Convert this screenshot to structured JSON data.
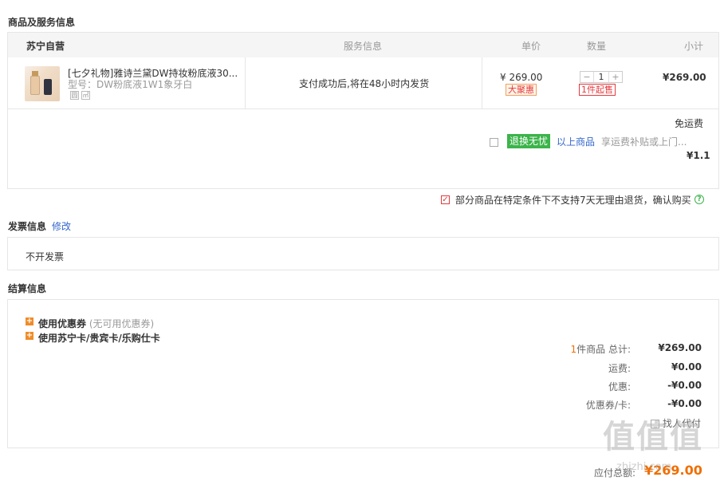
{
  "sections": {
    "goods_title": "商品及服务信息",
    "invoice_title": "发票信息",
    "invoice_edit": "修改",
    "settlement_title": "结算信息"
  },
  "order_table": {
    "store": "苏宁自营",
    "col_service": "服务信息",
    "col_price": "单价",
    "col_qty": "数量",
    "col_subtotal": "小计"
  },
  "product": {
    "name": "[七夕礼物]雅诗兰黛DW持妆粉底液30...",
    "model": "型号：DW粉底液1W1象牙白",
    "service": "支付成功后,将在48小时内发货",
    "price": "¥ 269.00",
    "price_tag": "大聚惠",
    "qty": "1",
    "qty_minus": "−",
    "qty_plus": "+",
    "min_tag": "1件起售",
    "subtotal": "¥269.00",
    "icon1": "圆",
    "icon2": "㎡"
  },
  "shipping": {
    "free_label": "免运费",
    "return_badge": "退换无忧",
    "return_link": "以上商品",
    "return_desc": "享运费补贴或上门...",
    "return_price": "¥1.1"
  },
  "notice": {
    "text": "部分商品在特定条件下不支持7天无理由退货，确认购买",
    "help": "?"
  },
  "invoice": {
    "value": "不开发票"
  },
  "settlement": {
    "coupon_label": "使用优惠券",
    "coupon_note": "(无可用优惠券)",
    "card_label": "使用苏宁卡/贵宾卡/乐购仕卡",
    "plus": "+",
    "items_count": "1",
    "items_label": "件商品  总计:",
    "items_total": "¥269.00",
    "shipping_label": "运费:",
    "shipping_val": "¥0.00",
    "discount_label": "优惠:",
    "discount_val": "-¥0.00",
    "coupon_card_label": "优惠券/卡:",
    "coupon_card_val": "-¥0.00",
    "proxy_pay": "找人代付",
    "payable_label": "应付总额:",
    "payable_val": "¥269.00"
  },
  "watermark": {
    "logo": "值值值",
    "site": "zhizhi.com"
  },
  "colors": {
    "accent": "#f06e00",
    "red": "#e4393c",
    "green": "#3bb44a",
    "link": "#3366cc"
  }
}
